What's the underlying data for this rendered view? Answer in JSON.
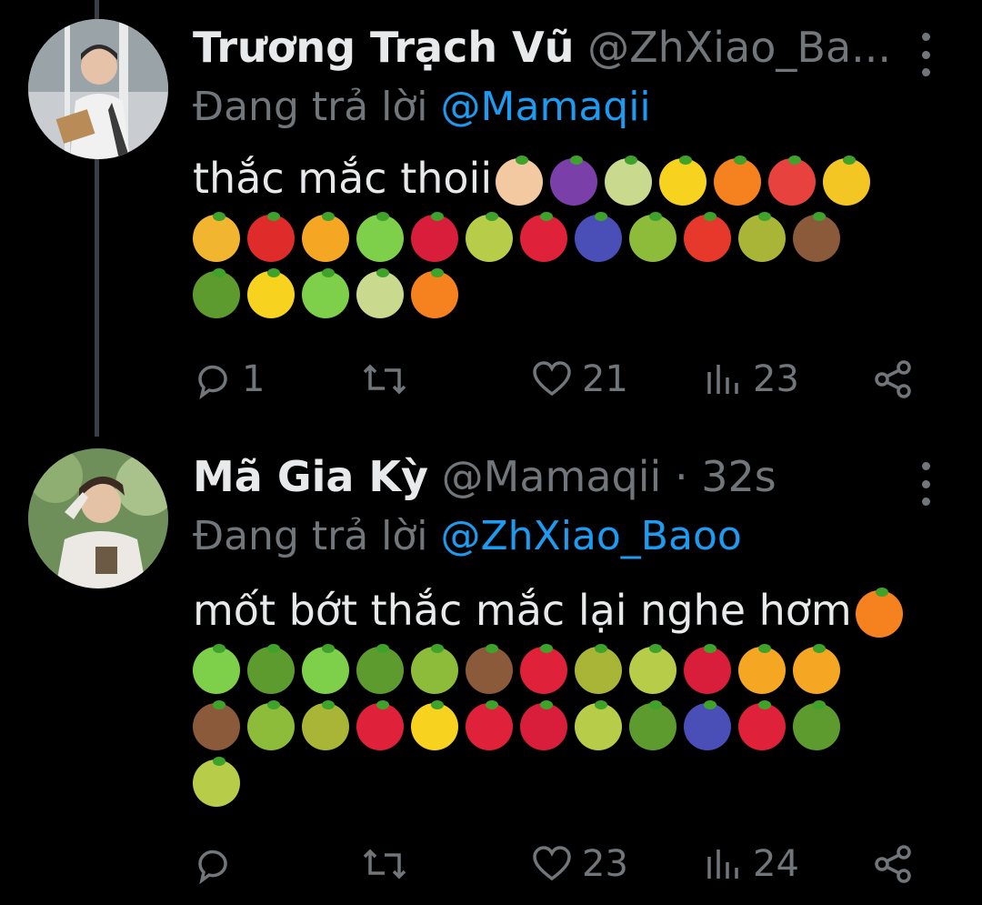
{
  "colors": {
    "background": "#000000",
    "text": "#e7e9ea",
    "muted": "#71767b",
    "link": "#1d9bf0",
    "thread_line": "#3a3f45"
  },
  "tweets": [
    {
      "display_name": "Trương Trạch Vũ",
      "handle": "@ZhXiao_Ba...",
      "replying_prefix": "Đang trả lời",
      "replying_to": "@Mamaqii",
      "text": "thắc mắc thoii",
      "emoji_rows": [
        [
          "heart-hands-emoji",
          "grapes-emoji",
          "melon-emoji",
          "lemon-emoji",
          "tangerine-emoji",
          "watermelon-emoji",
          "banana-emoji"
        ],
        [
          "pineapple-emoji",
          "red-apple-emoji",
          "mango-emoji",
          "green-apple-emoji",
          "cherries-emoji",
          "pear-emoji",
          "strawberry-emoji",
          "blueberries-emoji",
          "kiwi-emoji",
          "tomato-emoji",
          "olive-emoji",
          "coconut-emoji"
        ],
        [
          "avocado-emoji",
          "lemon-emoji",
          "green-apple-emoji",
          "melon-emoji",
          "tangerine-emoji"
        ]
      ],
      "stats": {
        "replies": "1",
        "retweets": "",
        "likes": "21",
        "views": "23"
      }
    },
    {
      "display_name": "Mã Gia Kỳ",
      "handle": "@Mamaqii",
      "separator": "·",
      "time": "32s",
      "replying_prefix": "Đang trả lời",
      "replying_to": "@ZhXiao_Baoo",
      "text": "mốt bớt thắc mắc lại nghe hơm",
      "emoji_rows": [
        [
          "green-apple-emoji",
          "avocado-emoji",
          "green-apple-emoji",
          "avocado-emoji",
          "kiwi-emoji",
          "coconut-emoji",
          "strawberry-emoji",
          "olive-emoji",
          "pear-emoji",
          "cherries-emoji",
          "mango-emoji",
          "mango-emoji"
        ],
        [
          "coconut-emoji",
          "kiwi-emoji",
          "olive-emoji",
          "strawberry-emoji",
          "lemon-emoji",
          "strawberry-emoji",
          "cherries-emoji",
          "pear-emoji",
          "avocado-emoji",
          "blueberries-emoji",
          "strawberry-emoji",
          "avocado-emoji"
        ],
        [
          "pear-emoji"
        ]
      ],
      "stats": {
        "replies": "",
        "retweets": "",
        "likes": "23",
        "views": "24"
      }
    }
  ]
}
